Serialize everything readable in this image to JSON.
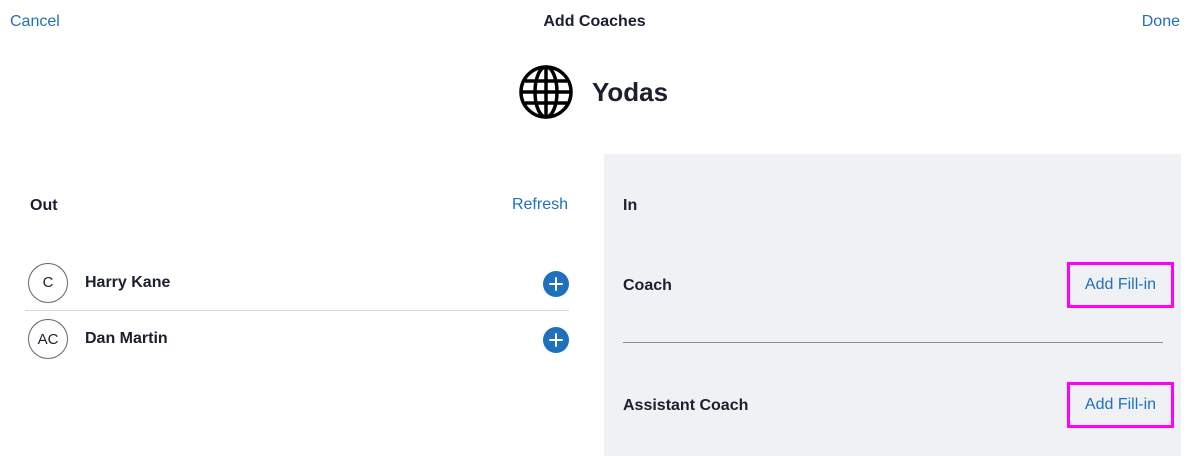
{
  "header": {
    "cancel_label": "Cancel",
    "title": "Add Coaches",
    "done_label": "Done"
  },
  "team": {
    "name": "Yodas",
    "icon": "globe-icon"
  },
  "out_panel": {
    "title": "Out",
    "refresh_label": "Refresh",
    "players": [
      {
        "initials": "C",
        "name": "Harry Kane"
      },
      {
        "initials": "AC",
        "name": "Dan Martin"
      }
    ]
  },
  "in_panel": {
    "title": "In",
    "roles": [
      {
        "label": "Coach",
        "action_label": "Add Fill-in"
      },
      {
        "label": "Assistant Coach",
        "action_label": "Add Fill-in"
      }
    ]
  },
  "colors": {
    "accent": "#1f6fbf",
    "panel_bg": "#eff1f5",
    "highlight": "#ff00ff"
  }
}
